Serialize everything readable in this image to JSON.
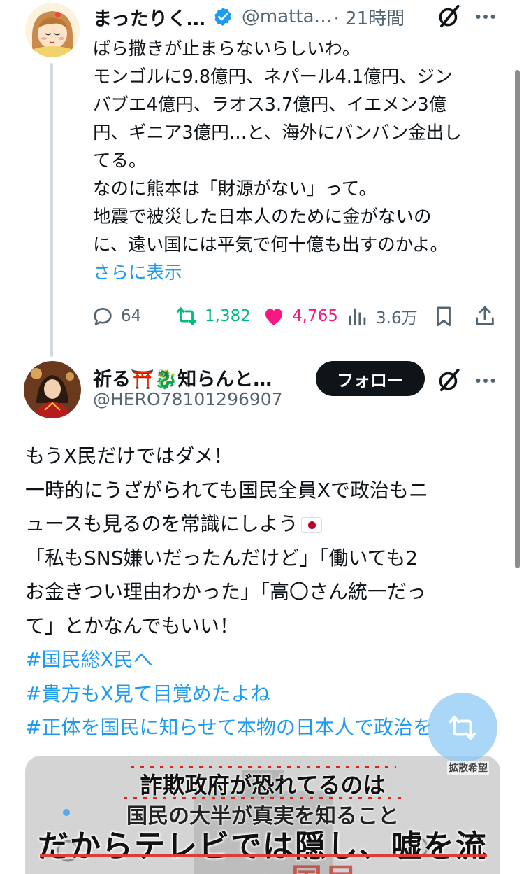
{
  "post1": {
    "author_name": "まったりく…",
    "handle": "@matta…",
    "time": "· 21時間",
    "lines": [
      "ばら撒きが止まらないらしいわ。",
      "モンゴルに9.8億円、ネパール4.1億円、ジン",
      "バブエ4億円、ラオス3.7億円、イエメン3億",
      "円、ギニア3億円…と、海外にバンバン金出し",
      "てる。",
      "なのに熊本は「財源がない」って。",
      "地震で被災した日本人のために金がないの",
      "に、遠い国には平気で何十億も出すのかよ。"
    ],
    "show_more": "さらに表示",
    "actions": {
      "replies": "64",
      "reposts": "1,382",
      "likes": "4,765",
      "views": "3.6万"
    },
    "colors": {
      "repost": "#00ba7c",
      "like": "#f91880",
      "link": "#1d9bf0"
    }
  },
  "post2": {
    "author_name": "祈る⛩️🐉知らんと…",
    "handle": "@HERO78101296907",
    "follow_label": "フォロー",
    "lines": [
      "もうX民だけではダメ！",
      "一時的にうざがられても国民全員Xで政治もニ",
      "ュースも見るのを常識にしよう"
    ],
    "lines2": [
      "「私もSNS嫌いだったんだけど」「働いても2",
      "お金きつい理由わかった」「高〇さん統一だっ",
      "て」とかなんでもいい！"
    ],
    "hashtags": [
      "#国民総X民へ",
      "#貴方もX見て目覚めたよね",
      "#正体を国民に知らせて本物の日本人で政治を"
    ],
    "media": {
      "line1": "詐欺政府が恐れてるのは",
      "line2": "国民の大半が真実を知ること",
      "line3": "だからテレビでは隠し、嘘を流す",
      "bottom_text": "国民"
    }
  },
  "fab": {
    "label": "拡散希望"
  }
}
